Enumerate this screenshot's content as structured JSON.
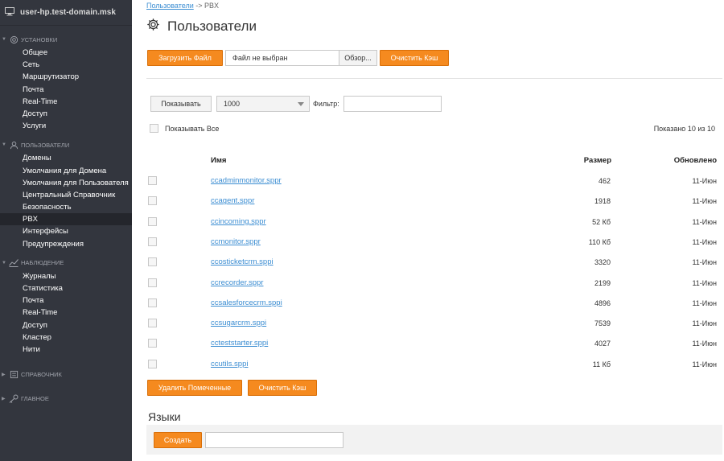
{
  "host": "user-hp.test-domain.msk",
  "sidebar": {
    "sections": [
      {
        "label": "УСТАНОВКИ",
        "icon": "gear-icon",
        "items": [
          "Общее",
          "Сеть",
          "Маршрутизатор",
          "Почта",
          "Real-Time",
          "Доступ",
          "Услуги"
        ]
      },
      {
        "label": "ПОЛЬЗОВАТЕЛИ",
        "icon": "user-icon",
        "items": [
          "Домены",
          "Умолчания для Домена",
          "Умолчания для Пользователя",
          "Центральный Справочник",
          "Безопасность",
          "PBX",
          "Интерфейсы",
          "Предупреждения"
        ]
      },
      {
        "label": "НАБЛЮДЕНИЕ",
        "icon": "chart-icon",
        "items": [
          "Журналы",
          "Статистика",
          "Почта",
          "Real-Time",
          "Доступ",
          "Кластер",
          "Нити"
        ]
      },
      {
        "label": "СПРАВОЧНИК",
        "icon": "directory-icon",
        "items": []
      },
      {
        "label": "ГЛАВНОЕ",
        "icon": "key-icon",
        "items": []
      }
    ],
    "active_item": "PBX"
  },
  "breadcrumb": {
    "link": "Пользователи",
    "sep": " -> ",
    "current": "PBX"
  },
  "page_title": "Пользователи",
  "upload": {
    "button": "Загрузить Файл",
    "file_value": "Файл не выбран",
    "browse": "Обзор...",
    "clear_cache": "Очистить Кэш"
  },
  "controls": {
    "show_button": "Показывать",
    "page_size": "1000",
    "filter_label": "Фильтр:",
    "filter_value": "",
    "show_all_label": "Показывать Все",
    "count_text": "Показано 10 из 10"
  },
  "table": {
    "headers": {
      "name": "Имя",
      "size": "Размер",
      "updated": "Обновлено"
    },
    "rows": [
      {
        "name": "ccadminmonitor.sppr",
        "size": "462",
        "updated": "11-Июн"
      },
      {
        "name": "ccagent.sppr",
        "size": "1918",
        "updated": "11-Июн"
      },
      {
        "name": "ccincoming.sppr",
        "size": "52 Кб",
        "updated": "11-Июн"
      },
      {
        "name": "ccmonitor.sppr",
        "size": "110 Кб",
        "updated": "11-Июн"
      },
      {
        "name": "ccosticketcrm.sppi",
        "size": "3320",
        "updated": "11-Июн"
      },
      {
        "name": "ccrecorder.sppr",
        "size": "2199",
        "updated": "11-Июн"
      },
      {
        "name": "ccsalesforcecrm.sppi",
        "size": "4896",
        "updated": "11-Июн"
      },
      {
        "name": "ccsugarcrm.sppi",
        "size": "7539",
        "updated": "11-Июн"
      },
      {
        "name": "ccteststarter.sppi",
        "size": "4027",
        "updated": "11-Июн"
      },
      {
        "name": "ccutils.sppi",
        "size": "11 Кб",
        "updated": "11-Июн"
      }
    ]
  },
  "bottom_buttons": {
    "delete_marked": "Удалить Помеченные",
    "clear_cache": "Очистить Кэш"
  },
  "languages": {
    "title": "Языки",
    "create_button": "Создать",
    "input_value": ""
  },
  "colors": {
    "accent": "#f58a1f",
    "sidebar_bg": "#33363e",
    "link": "#3b8dd2"
  }
}
